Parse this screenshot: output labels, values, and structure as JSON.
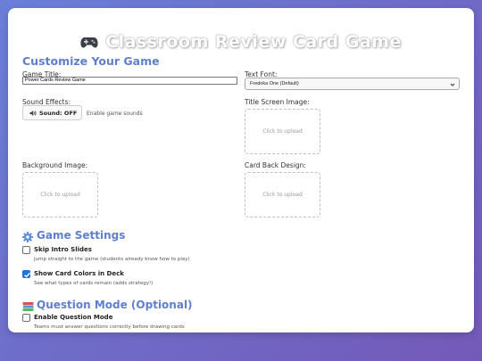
{
  "header": {
    "title": "Classroom Review Card Game",
    "icon": "gamepad-icon"
  },
  "customize": {
    "heading": "Customize Your Game",
    "game_title": {
      "label": "Game Title:",
      "value": "Power Cards Review Game"
    },
    "text_font": {
      "label": "Text Font:",
      "value": "Fredoka One (Default)"
    },
    "sound": {
      "label": "Sound Effects:",
      "button": "Sound: OFF",
      "hint": "Enable game sounds",
      "icon": "speaker-icon"
    },
    "title_image": {
      "label": "Title Screen Image:",
      "upload": "Click to upload"
    },
    "background_image": {
      "label": "Background Image:",
      "upload": "Click to upload"
    },
    "card_back": {
      "label": "Card Back Design:",
      "upload": "Click to upload"
    }
  },
  "game_settings": {
    "heading": "Game Settings",
    "icon": "gear-icon",
    "options": [
      {
        "label": "Skip Intro Slides",
        "desc": "Jump straight to the game (students already know how to play)",
        "checked": false
      },
      {
        "label": "Show Card Colors in Deck",
        "desc": "See what types of cards remain (adds strategy!)",
        "checked": true
      }
    ]
  },
  "question_mode": {
    "heading": "Question Mode (Optional)",
    "icon": "books-icon",
    "options": [
      {
        "label": "Enable Question Mode",
        "desc": "Teams must answer questions correctly before drawing cards",
        "checked": false
      }
    ]
  },
  "colors": {
    "accent": "#5f7fce",
    "checkbox": "#1a73e8"
  }
}
